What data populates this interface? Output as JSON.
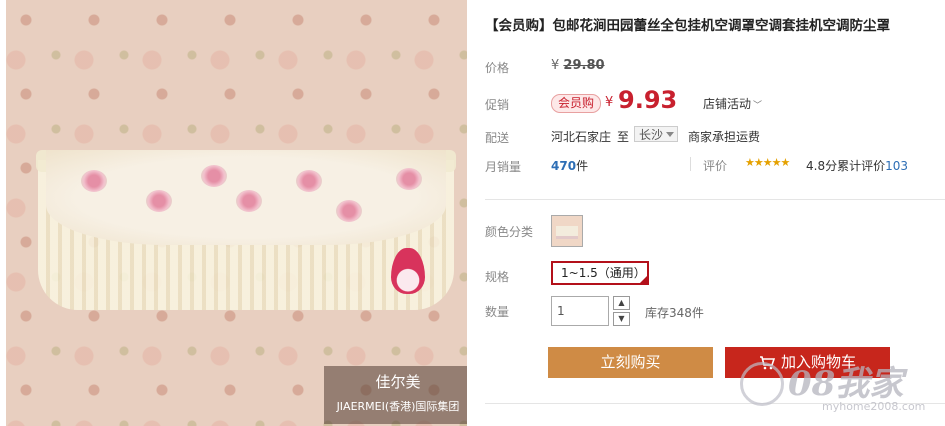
{
  "product": {
    "title": "【会员购】包邮花涧田园蕾丝全包挂机空调罩空调套挂机空调防尘罩",
    "image_brand": {
      "name": "佳尔美",
      "subtitle": "JIAERMEI(香港)国际集团"
    }
  },
  "labels": {
    "price": "价格",
    "promo": "促销",
    "delivery": "配送",
    "monthly_sales": "月销量",
    "reviews": "评价",
    "color": "颜色分类",
    "spec": "规格",
    "quantity": "数量"
  },
  "pricing": {
    "currency": "¥",
    "original": "29.80",
    "vip_badge": "会员购",
    "current": "9.93",
    "store_promo": "店铺活动"
  },
  "delivery": {
    "from": "河北石家庄",
    "to_word": "至",
    "to_city": "长沙",
    "fee": "商家承担运费"
  },
  "sales": {
    "count": "470",
    "unit": "件"
  },
  "reviews": {
    "stars": "★★★★★",
    "rating": "4.8分",
    "cumulative_label": "累计评价",
    "count": "103"
  },
  "options": {
    "spec_selected": "1~1.5（通用）"
  },
  "quantity": {
    "value": "1",
    "stock": "库存348件"
  },
  "buttons": {
    "buy_now": "立刻购买",
    "add_cart": "加入购物车"
  },
  "watermark": {
    "big": "08我家",
    "small": "myhome2008.com"
  },
  "colors": {
    "accent_red": "#c8202e",
    "buy_orange": "#cf8b45",
    "cart_red": "#c7261c",
    "link_blue": "#2d6eb5"
  }
}
